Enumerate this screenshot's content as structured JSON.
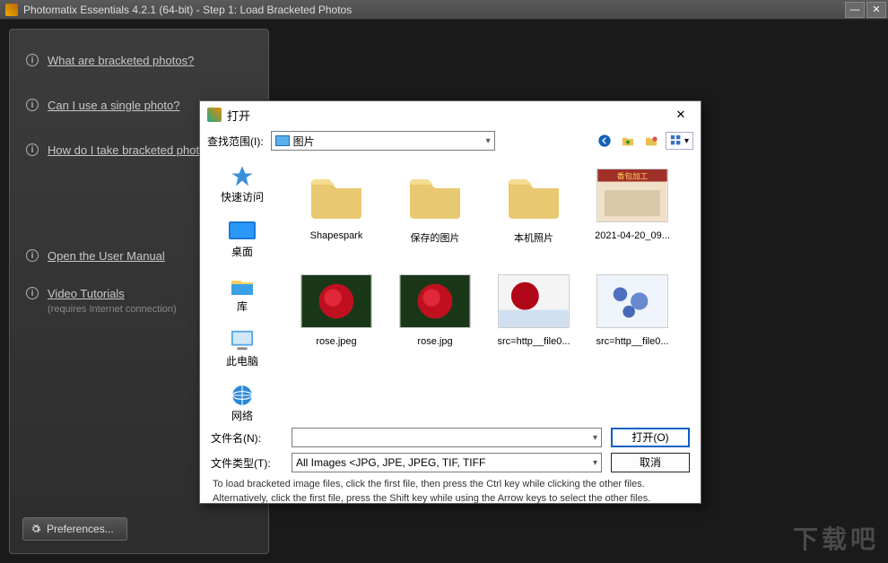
{
  "window": {
    "title": "Photomatix Essentials  4.2.1 (64-bit) - Step 1: Load Bracketed Photos"
  },
  "sidebar": {
    "items": [
      {
        "label": "What are bracketed photos?"
      },
      {
        "label": "Can I use a single photo?"
      },
      {
        "label": "How do I take bracketed photos?"
      },
      {
        "label": "Open the User Manual"
      },
      {
        "label": "Video Tutorials",
        "sub": "(requires Internet connection)"
      }
    ],
    "preferences": "Preferences..."
  },
  "dialog": {
    "title": "打开",
    "lookin_label": "查找范围(I):",
    "lookin_value": "图片",
    "places": [
      {
        "key": "quick",
        "label": "快速访问"
      },
      {
        "key": "desktop",
        "label": "桌面"
      },
      {
        "key": "library",
        "label": "库"
      },
      {
        "key": "thispc",
        "label": "此电脑"
      },
      {
        "key": "network",
        "label": "网络"
      }
    ],
    "row1": [
      {
        "type": "folder",
        "label": "Shapespark"
      },
      {
        "type": "folder",
        "label": "保存的图片"
      },
      {
        "type": "folder",
        "label": "本机照片"
      },
      {
        "type": "image",
        "label": "2021-04-20_09...",
        "preset": "poster"
      }
    ],
    "row2": [
      {
        "type": "image",
        "label": "rose.jpeg",
        "preset": "rose1"
      },
      {
        "type": "image",
        "label": "rose.jpg",
        "preset": "rose1"
      },
      {
        "type": "image",
        "label": "src=http__file0...",
        "preset": "rose2"
      },
      {
        "type": "image",
        "label": "src=http__file0...",
        "preset": "blue"
      }
    ],
    "filename_label": "文件名(N):",
    "filename_value": "",
    "filetype_label": "文件类型(T):",
    "filetype_value": "All Images <JPG, JPE, JPEG, TIF, TIFF",
    "open_btn": "打开(O)",
    "cancel_btn": "取消",
    "tip1": "To load bracketed image files, click the first file, then press the Ctrl key while clicking the other files.",
    "tip2": "Alternatively, click the first file, press the Shift key while using the Arrow keys to select the other files."
  },
  "watermark": "下载吧"
}
